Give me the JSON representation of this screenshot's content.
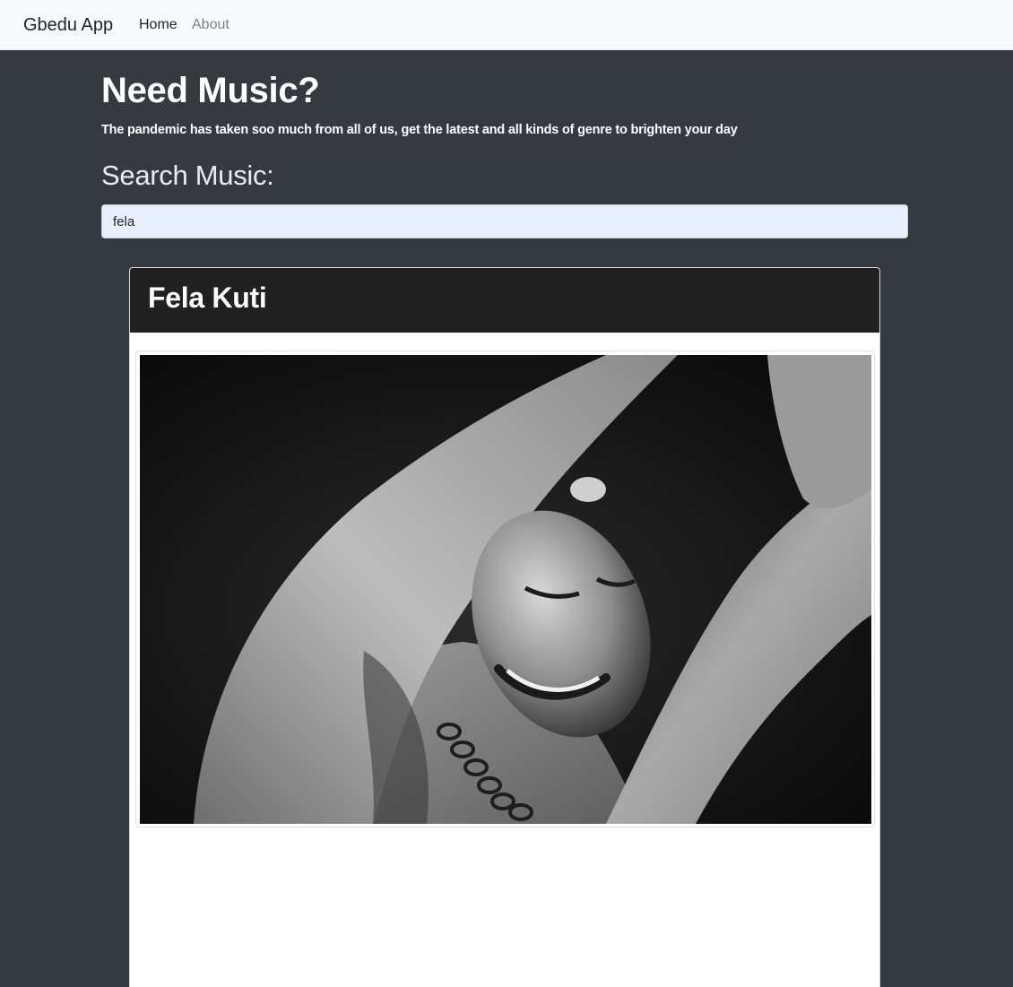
{
  "navbar": {
    "brand": "Gbedu App",
    "links": [
      {
        "label": "Home",
        "active": true
      },
      {
        "label": "About",
        "active": false
      }
    ]
  },
  "hero": {
    "title": "Need Music?",
    "subtitle": "The pandemic has taken soo much from all of us, get the latest and all kinds of genre to brighten your day"
  },
  "search": {
    "heading": "Search Music:",
    "value": "fela"
  },
  "result": {
    "artist_name": "Fela Kuti",
    "photo_icon": "artist-photo"
  },
  "colors": {
    "page_bg": "#343a40",
    "navbar_bg": "#f8f9fa",
    "card_header_bg": "#212121",
    "input_bg": "#e8f0fe"
  }
}
